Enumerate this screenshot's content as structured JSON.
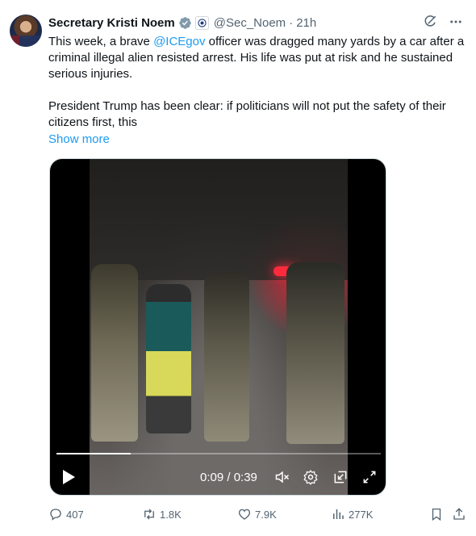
{
  "post": {
    "author_name": "Secretary Kristi Noem",
    "handle": "@Sec_Noem",
    "separator": "·",
    "time": "21h",
    "text_intro": "This week, a brave ",
    "mention": "@ICEgov",
    "text_rest": " officer was dragged many yards by a car after a criminal illegal alien resisted arrest. His life was put at risk and he sustained serious injuries.",
    "paragraph2": "President Trump has been clear: if politicians will not put the safety of their citizens first, this",
    "show_more": "Show more"
  },
  "video": {
    "timecode": "0:09 / 0:39",
    "progress_fraction": 0.23
  },
  "actions": {
    "replies": "407",
    "reposts": "1.8K",
    "likes": "7.9K",
    "views": "277K"
  },
  "icons": {
    "verified": "verified-badge-icon",
    "agency": "agency-badge-icon",
    "grok": "grok-icon",
    "more": "more-icon",
    "play": "play-icon",
    "mute": "mute-icon",
    "settings": "gear-icon",
    "pip": "picture-in-picture-icon",
    "fullscreen": "fullscreen-icon",
    "reply": "reply-icon",
    "repost": "repost-icon",
    "like": "heart-icon",
    "views": "views-icon",
    "bookmark": "bookmark-icon",
    "share": "share-icon"
  },
  "colors": {
    "text": "#0f1419",
    "secondary": "#536471",
    "link": "#1d9bf0",
    "verified": "#829aab"
  }
}
